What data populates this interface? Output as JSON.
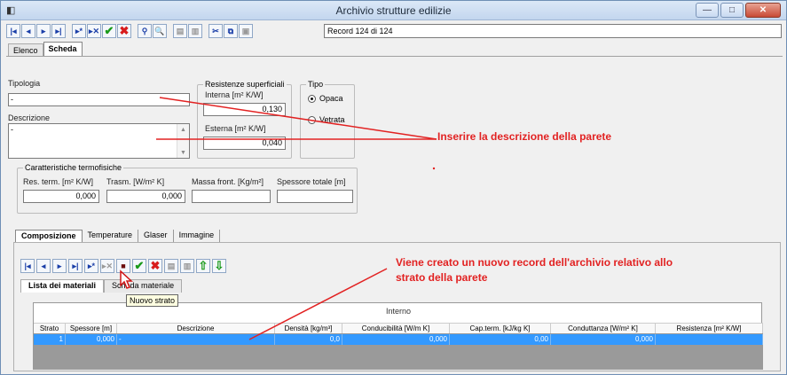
{
  "window": {
    "title": "Archivio strutture edilizie",
    "record_label": "Record 124 di 124"
  },
  "tabs_main": [
    "Elenco",
    "Scheda"
  ],
  "form": {
    "tipologia_label": "Tipologia",
    "tipologia_value": "-",
    "descrizione_label": "Descrizione",
    "descrizione_value": "-",
    "resistenze_group": "Resistenze superficiali",
    "interna_label": "Interna [m² K/W]",
    "interna_value": "0,130",
    "esterna_label": "Esterna [m² K/W]",
    "esterna_value": "0,040",
    "tipo_group": "Tipo",
    "tipo_opaca": "Opaca",
    "tipo_vetrata": "Vetrata",
    "caratteristiche_group": "Caratteristiche termofisiche",
    "res_term_label": "Res. term. [m² K/W]",
    "res_term_value": "0,000",
    "trasm_label": "Trasm. [W/m² K]",
    "trasm_value": "0,000",
    "massa_label": "Massa front. [Kg/m²]",
    "massa_value": "",
    "spessore_tot_label": "Spessore totale [m]",
    "spessore_tot_value": ""
  },
  "tabs_sub": [
    "Composizione",
    "Temperature",
    "Glaser",
    "Immagine"
  ],
  "tabs_inner": [
    "Lista dei materiali",
    "Scheda materiale"
  ],
  "tooltip": "Nuovo strato",
  "grid": {
    "caption": "Interno",
    "columns": [
      "Strato",
      "Spessore [m]",
      "Descrizione",
      "Densità [kg/m³]",
      "Conducibilità [W/m K]",
      "Cap.term. [kJ/kg K]",
      "Conduttanza [W/m² K]",
      "Resistenza [m² K/W]"
    ],
    "rows": [
      [
        "1",
        "0,000",
        "-",
        "0,0",
        "0,000",
        "0,00",
        "0,000",
        ""
      ]
    ]
  },
  "annotations": {
    "descrizione": "Inserire la descrizione della parete",
    "record_line1": "Viene creato un nuovo record dell'archivio relativo allo",
    "record_line2": "strato della parete"
  },
  "colors": {
    "annotation": "#e22222",
    "selection": "#3399ff"
  }
}
